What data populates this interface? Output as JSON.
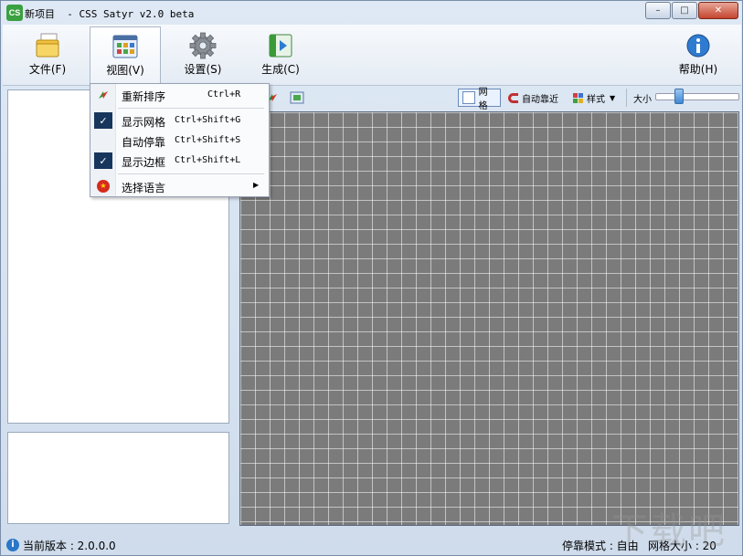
{
  "window": {
    "app_icon_text": "CS",
    "title": "新项目  - CSS Satyr v2.0 beta",
    "controls": {
      "minimize": "–",
      "maximize": "□",
      "close": "✕"
    }
  },
  "ribbon": {
    "buttons": [
      {
        "label": "文件(F)",
        "icon": "folder-icon"
      },
      {
        "label": "视图(V)",
        "icon": "view-grid-icon"
      },
      {
        "label": "设置(S)",
        "icon": "gear-icon"
      },
      {
        "label": "生成(C)",
        "icon": "generate-icon"
      },
      {
        "label": "帮助(H)",
        "icon": "info-icon"
      }
    ]
  },
  "view_menu": {
    "items": [
      {
        "label": "重新排序",
        "shortcut": "Ctrl+R",
        "icon": "reorder-icon",
        "checked": false
      },
      {
        "label": "显示网格",
        "shortcut": "Ctrl+Shift+G",
        "icon": "check-icon",
        "checked": true
      },
      {
        "label": "自动停靠",
        "shortcut": "Ctrl+Shift+S",
        "icon": "",
        "checked": false
      },
      {
        "label": "显示边框",
        "shortcut": "Ctrl+Shift+L",
        "icon": "check-icon",
        "checked": true
      },
      {
        "label": "选择语言",
        "shortcut": "",
        "icon": "china-flag-icon",
        "submenu": true
      }
    ]
  },
  "canvas_toolbar": {
    "grid_label": "网格",
    "auto_snap_label": "自动靠近",
    "style_label": "样式",
    "size_label": "大小",
    "size_level": 0.25
  },
  "status": {
    "info_icon": "i",
    "version_label": "当前版本 : 2.0.0.0",
    "dock_mode_label": "停靠模式 : 自由",
    "grid_size_label": "网格大小 : 20"
  },
  "watermark": "下载吧",
  "colors": {
    "canvas": "#7b7b7b",
    "menu_check": "#17365d",
    "app_icon": "#3aa040"
  }
}
